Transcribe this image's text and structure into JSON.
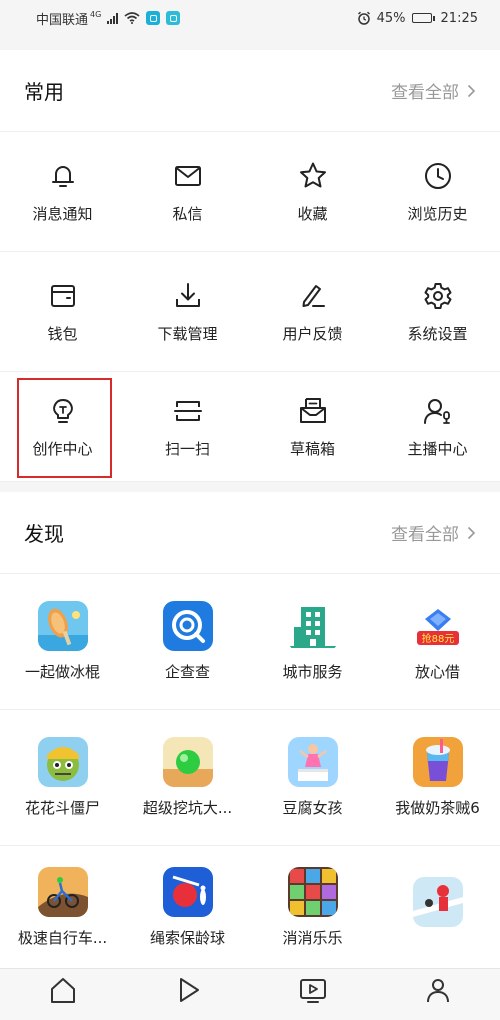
{
  "status_bar": {
    "carrier": "中国联通",
    "network": "4G",
    "battery": "45%",
    "battery_level": 0.45,
    "time": "21:25"
  },
  "common": {
    "title": "常用",
    "see_all": "查看全部",
    "items": [
      {
        "label": "消息通知",
        "icon": "bell-icon"
      },
      {
        "label": "私信",
        "icon": "mail-icon"
      },
      {
        "label": "收藏",
        "icon": "star-icon"
      },
      {
        "label": "浏览历史",
        "icon": "clock-icon"
      },
      {
        "label": "钱包",
        "icon": "wallet-icon"
      },
      {
        "label": "下载管理",
        "icon": "download-icon"
      },
      {
        "label": "用户反馈",
        "icon": "pen-icon"
      },
      {
        "label": "系统设置",
        "icon": "gear-icon"
      },
      {
        "label": "创作中心",
        "icon": "lightbulb-icon"
      },
      {
        "label": "扫一扫",
        "icon": "scan-icon"
      },
      {
        "label": "草稿箱",
        "icon": "drafts-icon"
      },
      {
        "label": "主播中心",
        "icon": "anchor-user-icon"
      }
    ]
  },
  "discover": {
    "title": "发现",
    "see_all": "查看全部",
    "items": [
      {
        "label": "一起做冰棍",
        "icon": "popsicle-app-icon"
      },
      {
        "label": "企查查",
        "icon": "qichacha-app-icon"
      },
      {
        "label": "城市服务",
        "icon": "city-building-icon"
      },
      {
        "label": "放心借",
        "icon": "loan-app-icon",
        "badge": "抢88元"
      },
      {
        "label": "花花斗僵尸",
        "icon": "zombie-game-icon"
      },
      {
        "label": "超级挖坑大...",
        "icon": "dig-game-icon"
      },
      {
        "label": "豆腐女孩",
        "icon": "tofu-girl-game-icon"
      },
      {
        "label": "我做奶茶贼6",
        "icon": "milk-tea-game-icon"
      },
      {
        "label": "极速自行车...",
        "icon": "bike-game-icon"
      },
      {
        "label": "绳索保龄球",
        "icon": "bowling-game-icon"
      },
      {
        "label": "消消乐乐",
        "icon": "match-game-icon"
      },
      {
        "label": "",
        "icon": "puzzle-game-icon"
      }
    ]
  },
  "colors": {
    "highlight": "#d62b2b",
    "city_green": "#2aa889",
    "qichacha_blue": "#1f7be0"
  }
}
